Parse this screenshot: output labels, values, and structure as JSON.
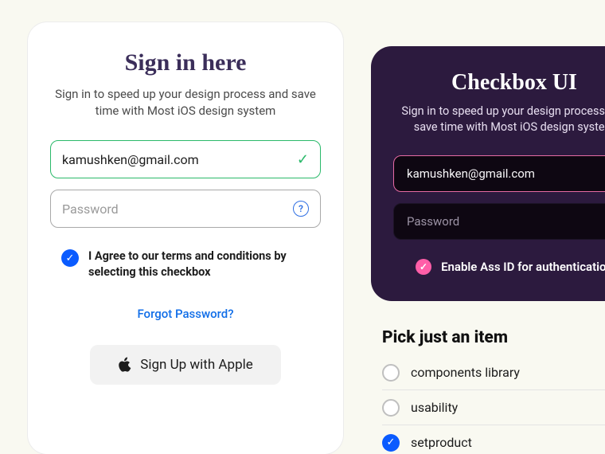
{
  "cardA": {
    "title": "Sign in here",
    "subtitle": "Sign in to speed up your design process and save time with Most iOS design system",
    "email_value": "kamushken@gmail.com",
    "password_placeholder": "Password",
    "terms_text": "I Agree to our terms and conditions by selecting this checkbox",
    "forgot_text": "Forgot Password?",
    "apple_button": "Sign Up with Apple"
  },
  "cardB": {
    "title": "Checkbox UI",
    "subtitle": "Sign in to speed up your design process and save time with Most iOS design system",
    "email_value": "kamushken@gmail.com",
    "password_placeholder": "Password",
    "enable_text": "Enable Ass ID for authentication"
  },
  "pick": {
    "title": "Pick just an item",
    "items": [
      {
        "label": "components library",
        "checked": false
      },
      {
        "label": "usability",
        "checked": false
      },
      {
        "label": "setproduct",
        "checked": true
      }
    ]
  }
}
